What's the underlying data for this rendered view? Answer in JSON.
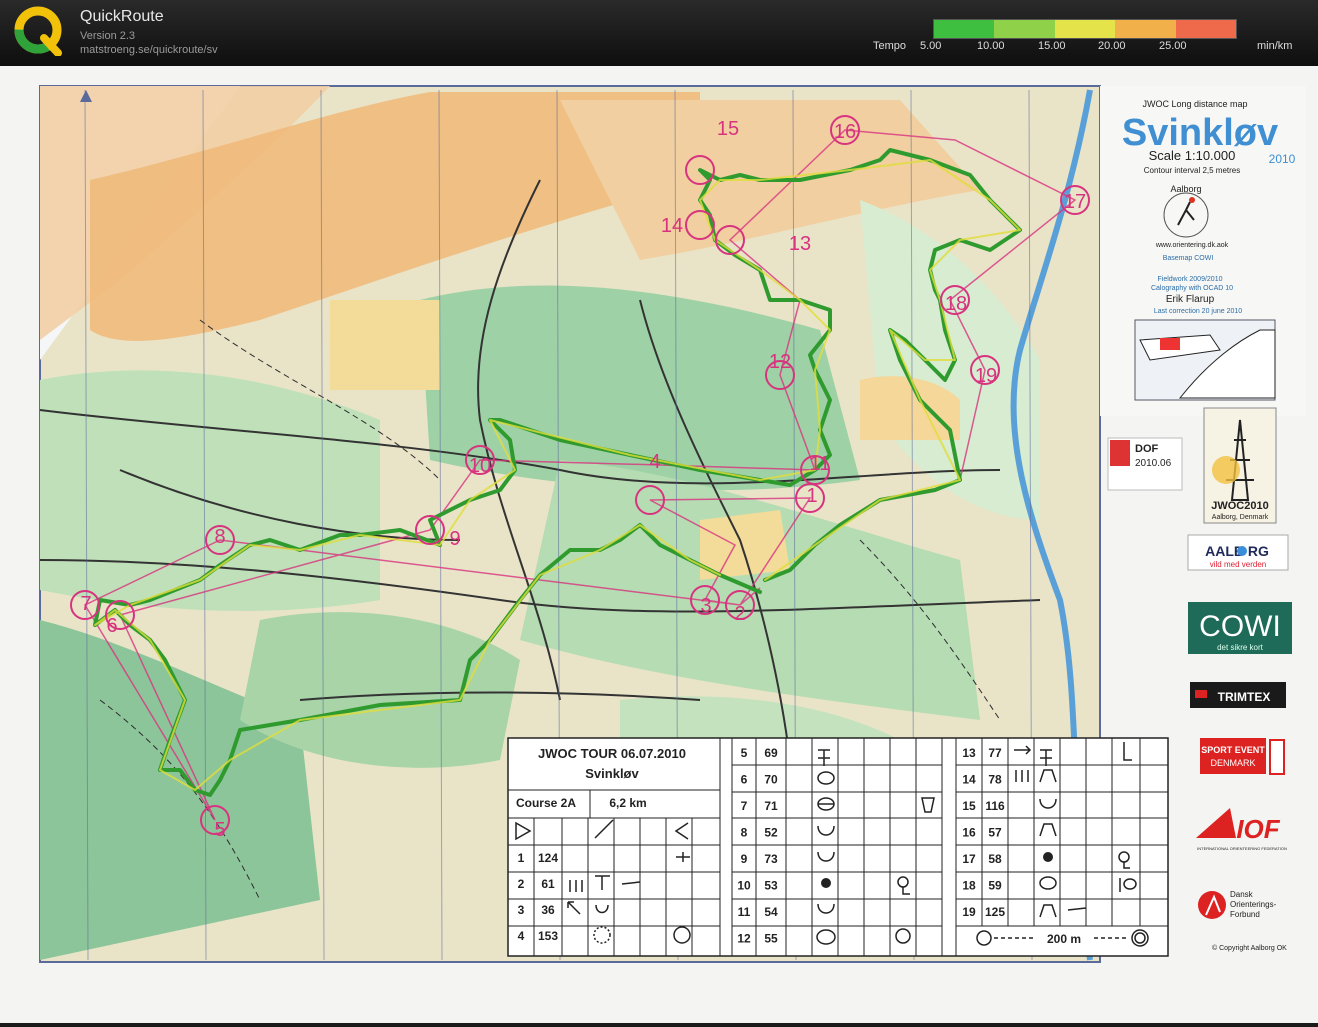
{
  "app": {
    "title": "QuickRoute",
    "version": "Version 2.3",
    "url": "matstroeng.se/quickroute/sv"
  },
  "legend": {
    "caption": "Tempo",
    "ticks": [
      "5.00",
      "10.00",
      "15.00",
      "20.00",
      "25.00"
    ],
    "unit": "min/km",
    "colors": [
      "#3fbf3f",
      "#8fd24a",
      "#e4e34a",
      "#f2b04a",
      "#ef6a4a"
    ]
  },
  "map_header": {
    "subtitle": "JWOC Long distance map",
    "title": "Svinkløv",
    "scale": "Scale  1:10.000",
    "year": "2010",
    "contour": "Contour interval 2,5 metres",
    "club": "Aalborg",
    "club_url": "www.orientering.dk.aok",
    "basemap": "Basemap  COWI",
    "fieldwork": "Fieldwork  2009/2010",
    "cartography": "Calography with  OCAD 10",
    "mapper": "Erik Flarup",
    "correction": "Last correction  20  june 2010"
  },
  "logos": {
    "dof": "DOF",
    "dof_year": "2010.06",
    "jwoc": "JWOC2010",
    "jwoc_sub": "Aalborg, Denmark",
    "aalborg": "AALB RG",
    "aalborg_tag": "vild med verden",
    "cowi": "COWI",
    "cowi_tag": "det sikre kort",
    "trimtex": "TRIMTEX",
    "sportevent": "SPORT EVENT",
    "sportevent_2": "DENMARK",
    "iof": "IOF",
    "iof_sub": "INTERNATIONAL ORIENTEERING FEDERATION",
    "dansk": "Dansk",
    "dansk_2": "Orienterings-",
    "dansk_3": "Forbund",
    "copyright": "© Copyright  Aalborg OK"
  },
  "control_card": {
    "title": "JWOC TOUR 06.07.2010",
    "place": "Svinkløv",
    "course": "Course 2A",
    "length": "6,2 km",
    "rows": [
      {
        "n": "1",
        "code": "124"
      },
      {
        "n": "2",
        "code": "61"
      },
      {
        "n": "3",
        "code": "36"
      },
      {
        "n": "4",
        "code": "153"
      },
      {
        "n": "5",
        "code": "69"
      },
      {
        "n": "6",
        "code": "70"
      },
      {
        "n": "7",
        "code": "71"
      },
      {
        "n": "8",
        "code": "52"
      },
      {
        "n": "9",
        "code": "73"
      },
      {
        "n": "10",
        "code": "53"
      },
      {
        "n": "11",
        "code": "54"
      },
      {
        "n": "12",
        "code": "55"
      },
      {
        "n": "13",
        "code": "77"
      },
      {
        "n": "14",
        "code": "78"
      },
      {
        "n": "15",
        "code": "116"
      },
      {
        "n": "16",
        "code": "57"
      },
      {
        "n": "17",
        "code": "58"
      },
      {
        "n": "18",
        "code": "59"
      },
      {
        "n": "19",
        "code": "125"
      }
    ],
    "finish": "200 m"
  },
  "controls": [
    "1",
    "2",
    "3",
    "4",
    "5",
    "6",
    "7",
    "8",
    "9",
    "10",
    "11",
    "12",
    "13",
    "14",
    "15",
    "16",
    "17",
    "18",
    "19"
  ]
}
